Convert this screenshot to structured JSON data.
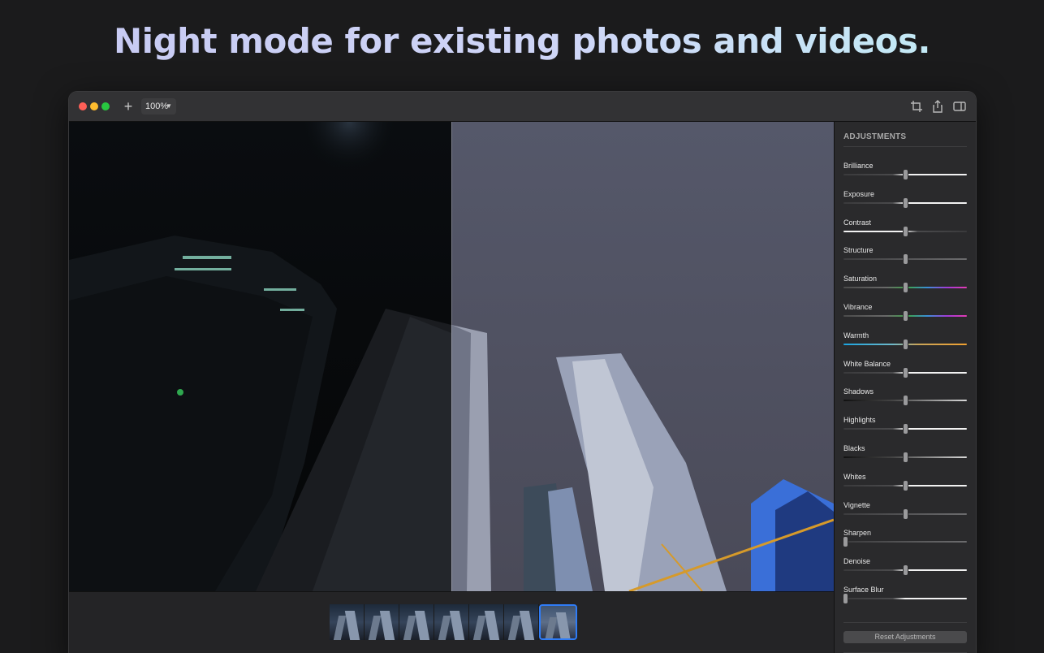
{
  "headline": "Night mode for existing photos and videos.",
  "toolbar": {
    "add_icon": "plus-icon",
    "zoom_label": "100%",
    "icons": [
      "crop-icon",
      "share-icon",
      "sidebar-toggle-icon"
    ]
  },
  "sidebar": {
    "title": "ADJUSTMENTS",
    "adjustments": [
      {
        "label": "Brilliance",
        "value": 0.5,
        "track": "plain"
      },
      {
        "label": "Exposure",
        "value": 0.5,
        "track": "plain"
      },
      {
        "label": "Contrast",
        "value": 0.5,
        "track": "plain-rev"
      },
      {
        "label": "Structure",
        "value": 0.5,
        "track": "gray"
      },
      {
        "label": "Saturation",
        "value": 0.5,
        "track": "rainbow"
      },
      {
        "label": "Vibrance",
        "value": 0.5,
        "track": "rainbow"
      },
      {
        "label": "Warmth",
        "value": 0.5,
        "track": "warmth"
      },
      {
        "label": "White Balance",
        "value": 0.5,
        "track": "plain"
      },
      {
        "label": "Shadows",
        "value": 0.5,
        "track": "dark"
      },
      {
        "label": "Highlights",
        "value": 0.5,
        "track": "plain"
      },
      {
        "label": "Blacks",
        "value": 0.5,
        "track": "dark"
      },
      {
        "label": "Whites",
        "value": 0.5,
        "track": "plain"
      },
      {
        "label": "Vignette",
        "value": 0.5,
        "track": "gray"
      },
      {
        "label": "Sharpen",
        "value": 0.0,
        "track": "gray"
      },
      {
        "label": "Denoise",
        "value": 0.5,
        "track": "plain"
      },
      {
        "label": "Surface Blur",
        "value": 0.0,
        "track": "plain"
      }
    ],
    "reset_label": "Reset Adjustments"
  },
  "filmstrip": {
    "count": 7,
    "selected_index": 6
  },
  "colors": {
    "accent": "#2f7cf6",
    "traffic_red": "#fe5f57",
    "traffic_yellow": "#febc2e",
    "traffic_green": "#28c840"
  }
}
